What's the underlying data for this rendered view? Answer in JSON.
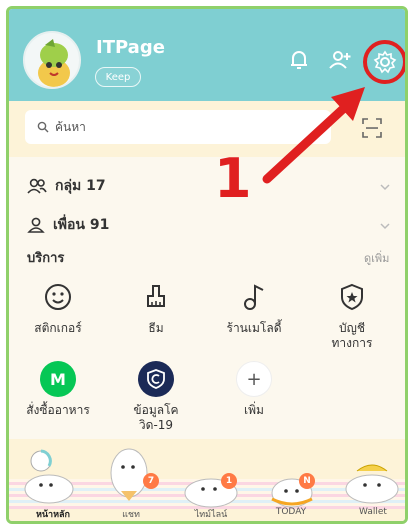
{
  "profile": {
    "name": "ITPage",
    "keep_label": "Keep"
  },
  "search": {
    "placeholder": "ค้นหา"
  },
  "annotation": {
    "step_number": "1"
  },
  "lists": {
    "groups_label": "กลุ่ม",
    "groups_count": "17",
    "friends_label": "เพื่อน",
    "friends_count": "91"
  },
  "services": {
    "title": "บริการ",
    "see_more": "ดูเพิ่ม",
    "items": [
      {
        "label": "สติกเกอร์",
        "icon": "smiley-icon"
      },
      {
        "label": "ธีม",
        "icon": "theme-brush-icon"
      },
      {
        "label": "ร้านเมโลดี้",
        "icon": "music-note-icon"
      },
      {
        "label": "บัญชี\nทางการ",
        "icon": "shield-star-icon"
      },
      {
        "label": "สั่งซื้ออาหาร",
        "icon": "line-man-icon",
        "color": "#06c755"
      },
      {
        "label": "ข้อมูลโค\nวิด-19",
        "icon": "covid-shield-icon",
        "color": "#1b2a57"
      },
      {
        "label": "เพิ่ม",
        "icon": "plus-icon"
      }
    ]
  },
  "bottom_nav": {
    "items": [
      {
        "label": "หน้าหลัก"
      },
      {
        "label": "แชท",
        "badge": "7"
      },
      {
        "label": "ไทม์ไลน์",
        "badge": "1"
      },
      {
        "label": "TODAY",
        "badge": "N"
      },
      {
        "label": "Wallet"
      }
    ]
  },
  "colors": {
    "header": "#7fcfd2",
    "highlight": "#e02020",
    "accent_green": "#06c755"
  }
}
